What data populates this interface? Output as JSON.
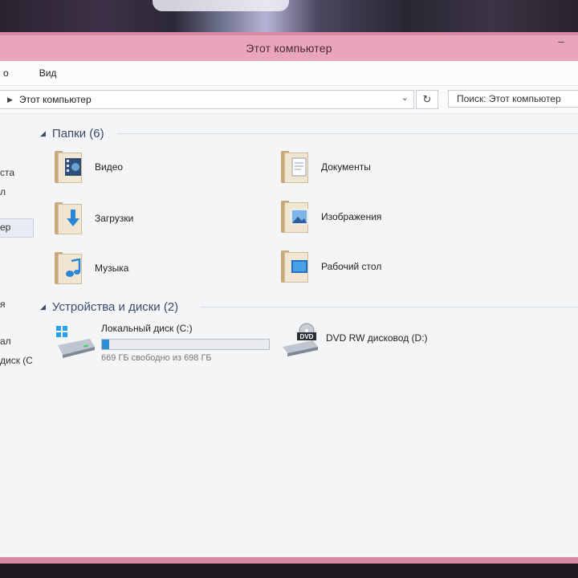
{
  "window": {
    "title": "Этот компьютер"
  },
  "menu": {
    "left_fragment": "о",
    "view": "Вид"
  },
  "address": {
    "path": "Этот компьютер",
    "search_placeholder": "Поиск: Этот компьютер"
  },
  "sidebar": {
    "items": [
      "ста",
      "л",
      "ер",
      "я",
      "ал",
      "диск (С"
    ]
  },
  "folders": {
    "header": "Папки (6)",
    "items": [
      {
        "label": "Видео",
        "icon": "video-folder-icon"
      },
      {
        "label": "Документы",
        "icon": "documents-folder-icon"
      },
      {
        "label": "Загрузки",
        "icon": "downloads-folder-icon"
      },
      {
        "label": "Изображения",
        "icon": "pictures-folder-icon"
      },
      {
        "label": "Музыка",
        "icon": "music-folder-icon"
      },
      {
        "label": "Рабочий стол",
        "icon": "desktop-folder-icon"
      }
    ]
  },
  "devices": {
    "header": "Устройства и диски (2)",
    "local_disk": {
      "name": "Локальный диск (C:)",
      "free_text": "669 ГБ свободно из 698 ГБ",
      "used_fraction": 0.042
    },
    "dvd": {
      "name": "DVD RW дисковод (D:)",
      "badge": "DVD"
    }
  },
  "colors": {
    "title_bar": "#e9a5bd",
    "window_border": "#d98aa5",
    "accent": "#2b8fd8"
  }
}
